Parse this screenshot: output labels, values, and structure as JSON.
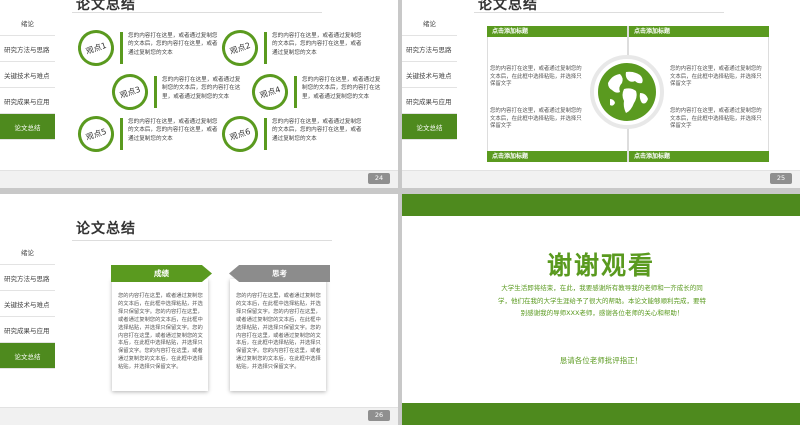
{
  "sidebar": {
    "items": [
      "绪论",
      "研究方法与思路",
      "关键技术与难点",
      "研究成果与应用",
      "论文总结"
    ]
  },
  "slide1": {
    "title": "论文总结",
    "page": "24",
    "points": [
      {
        "label": "观点1",
        "text": "您的内容打在这里，或者通过复制您的文本后，您的内容打在这里，或者通过复制您的文本"
      },
      {
        "label": "观点2",
        "text": "您的内容打在这里，或者通过复制您的文本后，您的内容打在这里，或者通过复制您的文本"
      },
      {
        "label": "观点3",
        "text": "您的内容打在这里，或者通过复制您的文本后，您的内容打在这里，或者通过复制您的文本"
      },
      {
        "label": "观点4",
        "text": "您的内容打在这里，或者通过复制您的文本后，您的内容打在这里，或者通过复制您的文本"
      },
      {
        "label": "观点5",
        "text": "您的内容打在这里，或者通过复制您的文本后，您的内容打在这里，或者通过复制您的文本"
      },
      {
        "label": "观点6",
        "text": "您的内容打在这里，或者通过复制您的文本后，您的内容打在这里，或者通过复制您的文本"
      }
    ]
  },
  "slide2": {
    "title": "论文总结",
    "page": "25",
    "headers": [
      "点击添加标题",
      "点击添加标题",
      "点击添加标题",
      "点击添加标题"
    ],
    "texts": [
      "您的内容打在这里，或者通过复制您的文本后，在此框中选择粘贴，并选择只保留文字",
      "您的内容打在这里，或者通过复制您的文本后，在此框中选择粘贴，并选择只保留文字",
      "您的内容打在这里，或者通过复制您的文本后，在此框中选择粘贴，并选择只保留文字",
      "您的内容打在这里，或者通过复制您的文本后，在此框中选择粘贴，并选择只保留文字"
    ],
    "accent": "#5a9a1f"
  },
  "slide3": {
    "title": "论文总结",
    "page": "26",
    "left": {
      "label": "成绩",
      "color": "#5a9a1f",
      "text": "您的内容打在这里，或者通过复制您的文本后，在此框中选择粘贴，并选择只保留文字。您的内容打在这里，或者通过复制您的文本后，在此框中选择粘贴，并选择只保留文字。您的内容打在这里，或者通过复制您的文本后，在此框中选择粘贴，并选择只保留文字。您的内容打在这里，或者通过复制您的文本后，在此框中选择粘贴，并选择只保留文字。"
    },
    "right": {
      "label": "思考",
      "color": "#8c8c8c",
      "text": "您的内容打在这里，或者通过复制您的文本后，在此框中选择粘贴，并选择只保留文字。您的内容打在这里，或者通过复制您的文本后，在此框中选择粘贴，并选择只保留文字。您的内容打在这里，或者通过复制您的文本后，在此框中选择粘贴，并选择只保留文字。您的内容打在这里，或者通过复制您的文本后，在此框中选择粘贴，并选择只保留文字。"
    }
  },
  "slide4": {
    "title": "谢谢观看",
    "body": "大学生活即将结束，在此，我要感谢所有教导我的老师和一齐成长的同学，他们在我的大学生涯给予了很大的帮助。本论文能够顺利完成，要特别感谢我的导师XXX老师，感谢各位老师的关心和帮助！",
    "closing": "恳请各位老师批评指正！",
    "accent": "#4e8a1e"
  }
}
